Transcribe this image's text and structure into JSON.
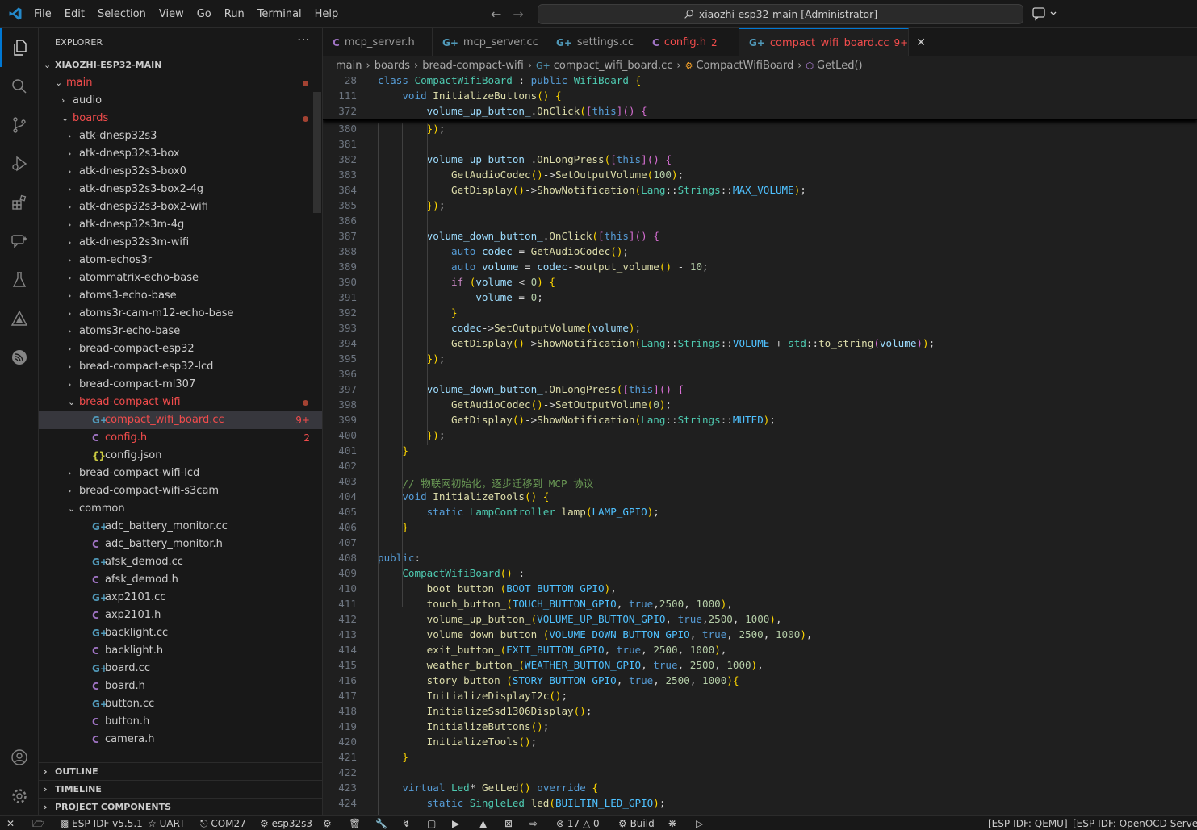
{
  "titlebar": {
    "menu": [
      "File",
      "Edit",
      "Selection",
      "View",
      "Go",
      "Run",
      "Terminal",
      "Help"
    ],
    "search": "xiaozhi-esp32-main [Administrator]"
  },
  "activity_bar": [
    "explorer-icon",
    "search-icon",
    "source-control-icon",
    "run-debug-icon",
    "extensions-icon",
    "chat-icon",
    "testing-icon",
    "esp-idf-icon",
    "espressif-icon",
    "accounts-icon",
    "settings-icon"
  ],
  "explorer": {
    "title": "EXPLORER",
    "root": "XIAOZHI-ESP32-MAIN",
    "items": [
      {
        "label": "main",
        "depth": 1,
        "type": "folder-open",
        "error": true,
        "dot": true
      },
      {
        "label": "audio",
        "depth": 2,
        "type": "folder"
      },
      {
        "label": "boards",
        "depth": 2,
        "type": "folder-open",
        "error": true,
        "dot": true
      },
      {
        "label": "atk-dnesp32s3",
        "depth": 3,
        "type": "folder"
      },
      {
        "label": "atk-dnesp32s3-box",
        "depth": 3,
        "type": "folder"
      },
      {
        "label": "atk-dnesp32s3-box0",
        "depth": 3,
        "type": "folder"
      },
      {
        "label": "atk-dnesp32s3-box2-4g",
        "depth": 3,
        "type": "folder"
      },
      {
        "label": "atk-dnesp32s3-box2-wifi",
        "depth": 3,
        "type": "folder"
      },
      {
        "label": "atk-dnesp32s3m-4g",
        "depth": 3,
        "type": "folder"
      },
      {
        "label": "atk-dnesp32s3m-wifi",
        "depth": 3,
        "type": "folder"
      },
      {
        "label": "atom-echos3r",
        "depth": 3,
        "type": "folder"
      },
      {
        "label": "atommatrix-echo-base",
        "depth": 3,
        "type": "folder"
      },
      {
        "label": "atoms3-echo-base",
        "depth": 3,
        "type": "folder"
      },
      {
        "label": "atoms3r-cam-m12-echo-base",
        "depth": 3,
        "type": "folder"
      },
      {
        "label": "atoms3r-echo-base",
        "depth": 3,
        "type": "folder"
      },
      {
        "label": "bread-compact-esp32",
        "depth": 3,
        "type": "folder"
      },
      {
        "label": "bread-compact-esp32-lcd",
        "depth": 3,
        "type": "folder"
      },
      {
        "label": "bread-compact-ml307",
        "depth": 3,
        "type": "folder"
      },
      {
        "label": "bread-compact-wifi",
        "depth": 3,
        "type": "folder-open",
        "error": true,
        "dot": true
      },
      {
        "label": "compact_wifi_board.cc",
        "depth": 4,
        "type": "cpp",
        "error": true,
        "badge": "9+",
        "selected": true
      },
      {
        "label": "config.h",
        "depth": 4,
        "type": "h",
        "error": true,
        "badge": "2"
      },
      {
        "label": "config.json",
        "depth": 4,
        "type": "json"
      },
      {
        "label": "bread-compact-wifi-lcd",
        "depth": 3,
        "type": "folder"
      },
      {
        "label": "bread-compact-wifi-s3cam",
        "depth": 3,
        "type": "folder"
      },
      {
        "label": "common",
        "depth": 3,
        "type": "folder-open"
      },
      {
        "label": "adc_battery_monitor.cc",
        "depth": 4,
        "type": "cpp"
      },
      {
        "label": "adc_battery_monitor.h",
        "depth": 4,
        "type": "h"
      },
      {
        "label": "afsk_demod.cc",
        "depth": 4,
        "type": "cpp"
      },
      {
        "label": "afsk_demod.h",
        "depth": 4,
        "type": "h"
      },
      {
        "label": "axp2101.cc",
        "depth": 4,
        "type": "cpp"
      },
      {
        "label": "axp2101.h",
        "depth": 4,
        "type": "h"
      },
      {
        "label": "backlight.cc",
        "depth": 4,
        "type": "cpp"
      },
      {
        "label": "backlight.h",
        "depth": 4,
        "type": "h"
      },
      {
        "label": "board.cc",
        "depth": 4,
        "type": "cpp"
      },
      {
        "label": "board.h",
        "depth": 4,
        "type": "h"
      },
      {
        "label": "button.cc",
        "depth": 4,
        "type": "cpp"
      },
      {
        "label": "button.h",
        "depth": 4,
        "type": "h"
      },
      {
        "label": "camera.h",
        "depth": 4,
        "type": "h"
      }
    ],
    "sections": [
      "OUTLINE",
      "TIMELINE",
      "PROJECT COMPONENTS"
    ]
  },
  "tabs": [
    {
      "label": "mcp_server.h",
      "type": "h"
    },
    {
      "label": "mcp_server.cc",
      "type": "cpp"
    },
    {
      "label": "settings.cc",
      "type": "cpp"
    },
    {
      "label": "config.h",
      "type": "h",
      "badge": "2",
      "error": true
    },
    {
      "label": "compact_wifi_board.cc",
      "type": "cpp",
      "badge": "9+",
      "error": true,
      "active": true
    }
  ],
  "breadcrumbs": [
    "main",
    "boards",
    "bread-compact-wifi",
    "compact_wifi_board.cc",
    "CompactWifiBoard",
    "GetLed()"
  ],
  "sticky_lines": [
    {
      "n": "28",
      "code": "class CompactWifiBoard : public WifiBoard {"
    },
    {
      "n": "111",
      "code": "    void InitializeButtons() {"
    },
    {
      "n": "372",
      "code": "        volume_up_button_.OnClick([this]() {"
    }
  ],
  "code_lines": [
    {
      "n": "380",
      "code": "        });"
    },
    {
      "n": "381",
      "code": ""
    },
    {
      "n": "382",
      "code": "        volume_up_button_.OnLongPress([this]() {"
    },
    {
      "n": "383",
      "code": "            GetAudioCodec()->SetOutputVolume(100);"
    },
    {
      "n": "384",
      "code": "            GetDisplay()->ShowNotification(Lang::Strings::MAX_VOLUME);"
    },
    {
      "n": "385",
      "code": "        });"
    },
    {
      "n": "386",
      "code": ""
    },
    {
      "n": "387",
      "code": "        volume_down_button_.OnClick([this]() {"
    },
    {
      "n": "388",
      "code": "            auto codec = GetAudioCodec();"
    },
    {
      "n": "389",
      "code": "            auto volume = codec->output_volume() - 10;"
    },
    {
      "n": "390",
      "code": "            if (volume < 0) {"
    },
    {
      "n": "391",
      "code": "                volume = 0;"
    },
    {
      "n": "392",
      "code": "            }"
    },
    {
      "n": "393",
      "code": "            codec->SetOutputVolume(volume);"
    },
    {
      "n": "394",
      "code": "            GetDisplay()->ShowNotification(Lang::Strings::VOLUME + std::to_string(volume));"
    },
    {
      "n": "395",
      "code": "        });"
    },
    {
      "n": "396",
      "code": ""
    },
    {
      "n": "397",
      "code": "        volume_down_button_.OnLongPress([this]() {"
    },
    {
      "n": "398",
      "code": "            GetAudioCodec()->SetOutputVolume(0);"
    },
    {
      "n": "399",
      "code": "            GetDisplay()->ShowNotification(Lang::Strings::MUTED);"
    },
    {
      "n": "400",
      "code": "        });"
    },
    {
      "n": "401",
      "code": "    }"
    },
    {
      "n": "402",
      "code": ""
    },
    {
      "n": "403",
      "code": "    // 物联网初始化，逐步迁移到 MCP 协议"
    },
    {
      "n": "404",
      "code": "    void InitializeTools() {"
    },
    {
      "n": "405",
      "code": "        static LampController lamp(LAMP_GPIO);"
    },
    {
      "n": "406",
      "code": "    }"
    },
    {
      "n": "407",
      "code": ""
    },
    {
      "n": "408",
      "code": "public:"
    },
    {
      "n": "409",
      "code": "    CompactWifiBoard() :"
    },
    {
      "n": "410",
      "code": "        boot_button_(BOOT_BUTTON_GPIO),"
    },
    {
      "n": "411",
      "code": "        touch_button_(TOUCH_BUTTON_GPIO, true,2500, 1000),"
    },
    {
      "n": "412",
      "code": "        volume_up_button_(VOLUME_UP_BUTTON_GPIO, true,2500, 1000),"
    },
    {
      "n": "413",
      "code": "        volume_down_button_(VOLUME_DOWN_BUTTON_GPIO, true, 2500, 1000),"
    },
    {
      "n": "414",
      "code": "        exit_button_(EXIT_BUTTON_GPIO, true, 2500, 1000),"
    },
    {
      "n": "415",
      "code": "        weather_button_(WEATHER_BUTTON_GPIO, true, 2500, 1000),"
    },
    {
      "n": "416",
      "code": "        story_button_(STORY_BUTTON_GPIO, true, 2500, 1000){"
    },
    {
      "n": "417",
      "code": "        InitializeDisplayI2c();"
    },
    {
      "n": "418",
      "code": "        InitializeSsd1306Display();"
    },
    {
      "n": "419",
      "code": "        InitializeButtons();"
    },
    {
      "n": "420",
      "code": "        InitializeTools();"
    },
    {
      "n": "421",
      "code": "    }"
    },
    {
      "n": "422",
      "code": ""
    },
    {
      "n": "423",
      "code": "    virtual Led* GetLed() override {"
    },
    {
      "n": "424",
      "code": "        static SingleLed led(BUILTIN_LED_GPIO);"
    }
  ],
  "statusbar": {
    "idf_version": "ESP-IDF v5.5.1",
    "uart": "UART",
    "port": "COM27",
    "target": "esp32s3",
    "errors": "17",
    "warnings": "0",
    "build": "Build",
    "qemu": "[ESP-IDF: QEMU]",
    "openocd": "[ESP-IDF: OpenOCD Server]"
  }
}
